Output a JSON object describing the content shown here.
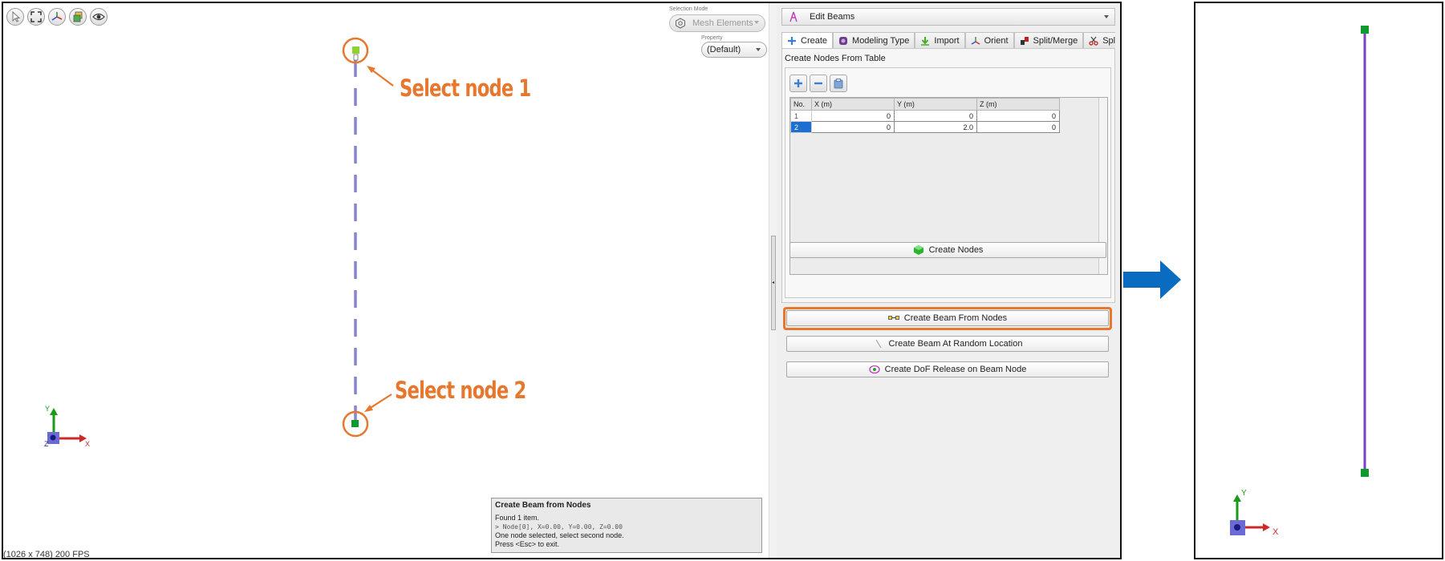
{
  "viewport": {
    "toolbar_icons": [
      "select-cursor-icon",
      "fit-view-icon",
      "axis-triad-icon",
      "layers-icon",
      "eye-icon"
    ],
    "selection_mode_label": "Selection Mode",
    "selection_mode_value": "Mesh Elements",
    "property_label": "Property",
    "property_value": "(Default)",
    "annotations": [
      "Select node 1",
      "Select node 2"
    ],
    "fps_text": "(1026 x 748) 200 FPS",
    "axis_labels": {
      "x": "X",
      "y": "Y",
      "z": "Z"
    }
  },
  "status": {
    "title": "Create Beam from Nodes",
    "line1": "Found 1 item.",
    "line2": "> Node[0], X=0.00, Y=0.00, Z=0.00",
    "line3": "One node selected, select second node.",
    "line4": "Press <Esc> to exit."
  },
  "panel": {
    "header_title": "Edit Beams",
    "tabs": [
      "Create",
      "Modeling Type",
      "Import",
      "Orient",
      "Split/Merge",
      "Spli"
    ],
    "section_title": "Create Nodes From Table",
    "table": {
      "headers": [
        "No.",
        "X (m)",
        "Y (m)",
        "Z (m)"
      ],
      "rows": [
        [
          "1",
          "0",
          "0",
          "0"
        ],
        [
          "2",
          "0",
          "2.0",
          "0"
        ]
      ],
      "selected_row": 2
    },
    "create_nodes_label": "Create Nodes",
    "create_beam_from_nodes_label": "Create Beam From Nodes",
    "create_beam_random_label": "Create Beam At Random Location",
    "create_dof_release_label": "Create DoF Release on Beam Node"
  },
  "result_view": {
    "axis_labels": {
      "x": "X",
      "y": "Y"
    }
  },
  "colors": {
    "annotation": "#e8772e",
    "beam_dashed": "#8585d0",
    "beam_solid": "#7a3fc8",
    "node_green": "#0e9a2e",
    "node_light_green": "#8fd12e",
    "arrow_blue": "#0a6cc0",
    "selection_blue": "#1a6fd1"
  }
}
